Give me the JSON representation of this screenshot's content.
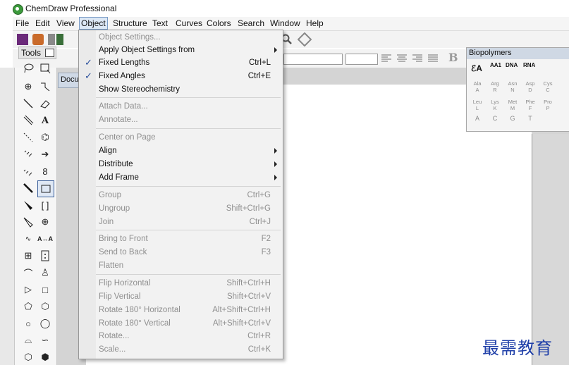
{
  "window": {
    "title": "ChemDraw Professional"
  },
  "menubar": [
    "File",
    "Edit",
    "View",
    "Object",
    "Structure",
    "Text",
    "Curves",
    "Colors",
    "Search",
    "Window",
    "Help"
  ],
  "tools": {
    "header": "Tools"
  },
  "document": {
    "tab_label": "Docu"
  },
  "object_menu": {
    "items": [
      {
        "label": "Object Settings...",
        "shortcut": "",
        "enabled": false,
        "checked": false,
        "submenu": false
      },
      {
        "label": "Apply Object Settings from",
        "shortcut": "",
        "enabled": true,
        "checked": false,
        "submenu": true
      },
      {
        "label": "Fixed Lengths",
        "shortcut": "Ctrl+L",
        "enabled": true,
        "checked": true,
        "submenu": false
      },
      {
        "label": "Fixed Angles",
        "shortcut": "Ctrl+E",
        "enabled": true,
        "checked": true,
        "submenu": false
      },
      {
        "label": "Show Stereochemistry",
        "shortcut": "",
        "enabled": true,
        "checked": false,
        "submenu": false
      },
      {
        "label": "Attach Data...",
        "shortcut": "",
        "enabled": false,
        "checked": false,
        "submenu": false
      },
      {
        "label": "Annotate...",
        "shortcut": "",
        "enabled": false,
        "checked": false,
        "submenu": false
      },
      {
        "label": "Center on Page",
        "shortcut": "",
        "enabled": false,
        "checked": false,
        "submenu": false
      },
      {
        "label": "Align",
        "shortcut": "",
        "enabled": true,
        "checked": false,
        "submenu": true
      },
      {
        "label": "Distribute",
        "shortcut": "",
        "enabled": true,
        "checked": false,
        "submenu": true
      },
      {
        "label": "Add Frame",
        "shortcut": "",
        "enabled": true,
        "checked": false,
        "submenu": true
      },
      {
        "label": "Group",
        "shortcut": "Ctrl+G",
        "enabled": false,
        "checked": false,
        "submenu": false
      },
      {
        "label": "Ungroup",
        "shortcut": "Shift+Ctrl+G",
        "enabled": false,
        "checked": false,
        "submenu": false
      },
      {
        "label": "Join",
        "shortcut": "Ctrl+J",
        "enabled": false,
        "checked": false,
        "submenu": false
      },
      {
        "label": "Bring to Front",
        "shortcut": "F2",
        "enabled": false,
        "checked": false,
        "submenu": false
      },
      {
        "label": "Send to Back",
        "shortcut": "F3",
        "enabled": false,
        "checked": false,
        "submenu": false
      },
      {
        "label": "Flatten",
        "shortcut": "",
        "enabled": false,
        "checked": false,
        "submenu": false
      },
      {
        "label": "Flip Horizontal",
        "shortcut": "Shift+Ctrl+H",
        "enabled": false,
        "checked": false,
        "submenu": false
      },
      {
        "label": "Flip Vertical",
        "shortcut": "Shift+Ctrl+V",
        "enabled": false,
        "checked": false,
        "submenu": false
      },
      {
        "label": "Rotate 180° Horizontal",
        "shortcut": "Alt+Shift+Ctrl+H",
        "enabled": false,
        "checked": false,
        "submenu": false
      },
      {
        "label": "Rotate 180° Vertical",
        "shortcut": "Alt+Shift+Ctrl+V",
        "enabled": false,
        "checked": false,
        "submenu": false
      },
      {
        "label": "Rotate...",
        "shortcut": "Ctrl+R",
        "enabled": false,
        "checked": false,
        "submenu": false
      },
      {
        "label": "Scale...",
        "shortcut": "Ctrl+K",
        "enabled": false,
        "checked": false,
        "submenu": false
      }
    ]
  },
  "biopolymers": {
    "title": "Biopolymers",
    "top": [
      "AA1",
      "DNA",
      "RNA"
    ],
    "amino_rows": [
      [
        [
          "Ala",
          "A"
        ],
        [
          "Arg",
          "R"
        ],
        [
          "Asn",
          "N"
        ],
        [
          "Asp",
          "D"
        ],
        [
          "Cys",
          "C"
        ]
      ],
      [
        [
          "Leu",
          "L"
        ],
        [
          "Lys",
          "K"
        ],
        [
          "Met",
          "M"
        ],
        [
          "Phe",
          "F"
        ],
        [
          "Pro",
          "P"
        ]
      ]
    ],
    "nucleotides": [
      "A",
      "C",
      "G",
      "T"
    ]
  },
  "watermark": "最需教育",
  "colors": {
    "accent": "#2a4f9c",
    "disabled": "#8f8f8f",
    "watermark": "#1f3fa8"
  }
}
